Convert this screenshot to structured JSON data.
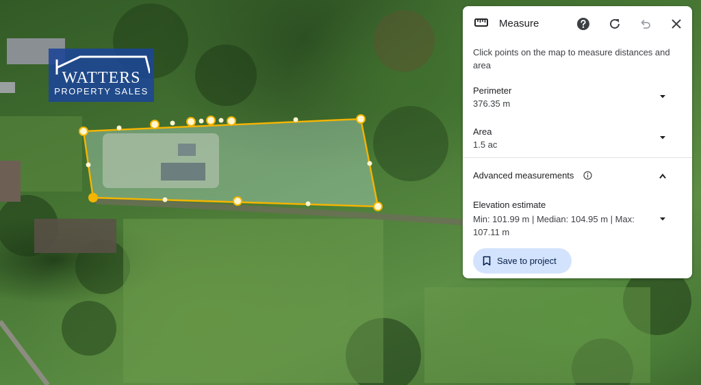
{
  "logo": {
    "name": "WATTERS",
    "subtitle": "PROPERTY SALES"
  },
  "panel": {
    "title": "Measure",
    "hint": "Click points on the map to measure distances and area",
    "icons": {
      "ruler": "ruler-icon",
      "help": "help-circle-icon",
      "refresh": "refresh-icon",
      "undo": "undo-icon",
      "close": "close-icon"
    },
    "perimeter": {
      "label": "Perimeter",
      "value": "376.35 m"
    },
    "area": {
      "label": "Area",
      "value": "1.5 ac"
    },
    "advanced": {
      "label": "Advanced measurements",
      "expanded": true
    },
    "elevation": {
      "label": "Elevation estimate",
      "value": "Min: 101.99 m | Median: 104.95 m | Max: 107.11 m"
    },
    "save_label": "Save to project"
  },
  "colors": {
    "measure_line": "#f4b400",
    "vertex_fill": "#fff6d0",
    "save_button_bg": "#d3e3fd",
    "logo_bg": "#1c4696"
  }
}
